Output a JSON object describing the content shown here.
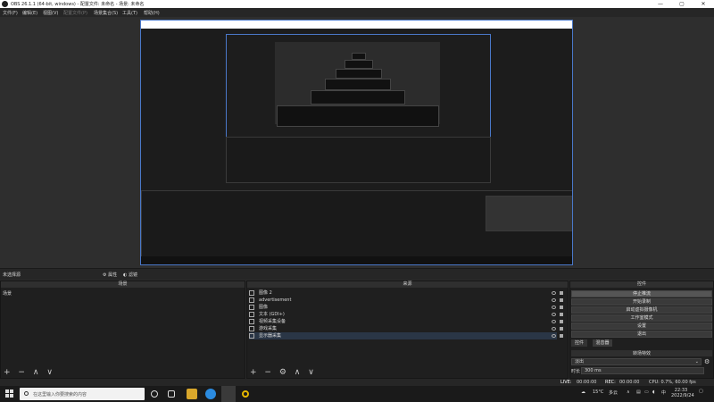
{
  "window": {
    "title": "OBS 26.1.1 (64-bit, windows) - 配置文件: 未命名 - 场景: 未命名",
    "minimize": "—",
    "maximize": "▢",
    "close": "✕"
  },
  "menu": {
    "items": [
      "文件(F)",
      "编辑(E)",
      "视图(V)",
      "配置文件(P)",
      "场景集合(S)",
      "工具(T)",
      "帮助(H)"
    ]
  },
  "preview_tabs": {
    "status": "未选择源",
    "properties": "属性",
    "filters": "滤镜"
  },
  "scenes": {
    "header": "场景",
    "items": [
      "场景"
    ],
    "toolbar": [
      "+",
      "−",
      "∧",
      "∨"
    ]
  },
  "sources": {
    "header": "来源",
    "items": [
      {
        "label": "图像 2",
        "icon": "image-icon"
      },
      {
        "label": "advertisement",
        "icon": "image-icon"
      },
      {
        "label": "图像",
        "icon": "image-icon"
      },
      {
        "label": "文本 (GDI+)",
        "icon": "text-icon"
      },
      {
        "label": "视频采集设备",
        "icon": "camera-icon"
      },
      {
        "label": "游戏采集",
        "icon": "gamepad-icon"
      },
      {
        "label": "显示器采集",
        "icon": "monitor-icon"
      }
    ],
    "active_index": 6,
    "toolbar": [
      "+",
      "−",
      "⚙",
      "∧",
      "∨"
    ]
  },
  "controls": {
    "header": "控件",
    "buttons": [
      "停止推流",
      "开始录制",
      "启动虚拟摄像机",
      "工作室模式",
      "设置",
      "退出"
    ],
    "active_index": 0
  },
  "bottom_tabs": [
    "控件",
    "转场模式",
    "混音器"
  ],
  "transitions": {
    "header": "转场特效",
    "select_value": "淡出",
    "duration_label": "时长",
    "duration_value": "300 ms"
  },
  "statusbar": {
    "live_label": "LIVE:",
    "live_time": "00:00:00",
    "rec_label": "REC:",
    "rec_time": "00:00:00",
    "cpu": "CPU: 0.7%, 60.00 fps"
  },
  "taskbar": {
    "search_placeholder": "在这里输入你要搜索的内容",
    "weather": "15°C",
    "weather_desc": "多云",
    "ime": "中",
    "time": "22:33",
    "date": "2022/9/24"
  },
  "colors": {
    "selection": "#4a78c9",
    "panel": "#1f1f1f",
    "header": "#2f2f2f",
    "titlebar": "#ffffff"
  }
}
